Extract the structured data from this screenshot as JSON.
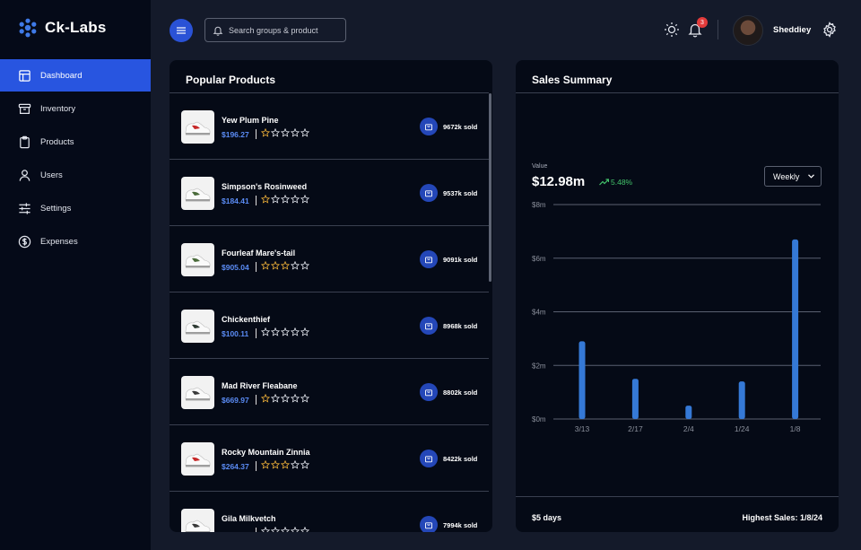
{
  "brand": {
    "name": "Ck-Labs"
  },
  "sidebar": {
    "items": [
      {
        "label": "Dashboard",
        "icon": "layout-icon"
      },
      {
        "label": "Inventory",
        "icon": "archive-icon"
      },
      {
        "label": "Products",
        "icon": "clipboard-icon"
      },
      {
        "label": "Users",
        "icon": "user-icon"
      },
      {
        "label": "Settings",
        "icon": "sliders-icon"
      },
      {
        "label": "Expenses",
        "icon": "dollar-circle-icon"
      }
    ]
  },
  "header": {
    "search_placeholder": "Search groups & product",
    "notification_count": "3",
    "username": "Sheddiey"
  },
  "products": {
    "title": "Popular Products",
    "items": [
      {
        "name": "Yew Plum Pine",
        "price": "$196.27",
        "rating": 1,
        "sold": "9672k sold",
        "accent": "#c62828"
      },
      {
        "name": "Simpson's Rosinweed",
        "price": "$184.41",
        "rating": 1,
        "sold": "9537k sold",
        "accent": "#4a6b3a"
      },
      {
        "name": "Fourleaf Mare's-tail",
        "price": "$905.04",
        "rating": 3,
        "sold": "9091k sold",
        "accent": "#4a6b3a"
      },
      {
        "name": "Chickenthief",
        "price": "$100.11",
        "rating": 0,
        "sold": "8968k sold",
        "accent": "#2e3a33"
      },
      {
        "name": "Mad River Fleabane",
        "price": "$669.97",
        "rating": 1,
        "sold": "8802k sold",
        "accent": "#3a3a3a"
      },
      {
        "name": "Rocky Mountain Zinnia",
        "price": "$264.37",
        "rating": 3,
        "sold": "8422k sold",
        "accent": "#c62828"
      },
      {
        "name": "Gila Milkvetch",
        "price": "",
        "rating": 0,
        "sold": "7994k sold",
        "accent": "#3a3a3a"
      }
    ]
  },
  "sales": {
    "title": "Sales Summary",
    "value_label": "Value",
    "value": "$12.98m",
    "change": "5.48%",
    "period": "Weekly",
    "footer_left": "$5 days",
    "footer_right": "Highest Sales: 1/8/24"
  },
  "colors": {
    "accent": "#2855e0",
    "bar": "#3579d6",
    "positive": "#43c46b",
    "star": "#f3b43a"
  },
  "chart_data": {
    "type": "bar",
    "categories": [
      "3/13",
      "2/17",
      "2/4",
      "1/24",
      "1/8"
    ],
    "values": [
      2.9,
      1.5,
      0.5,
      1.4,
      6.7
    ],
    "yticks": [
      "$0m",
      "$2m",
      "$4m",
      "$6m",
      "$8m"
    ],
    "ylim": [
      0,
      8
    ],
    "grid": true
  }
}
